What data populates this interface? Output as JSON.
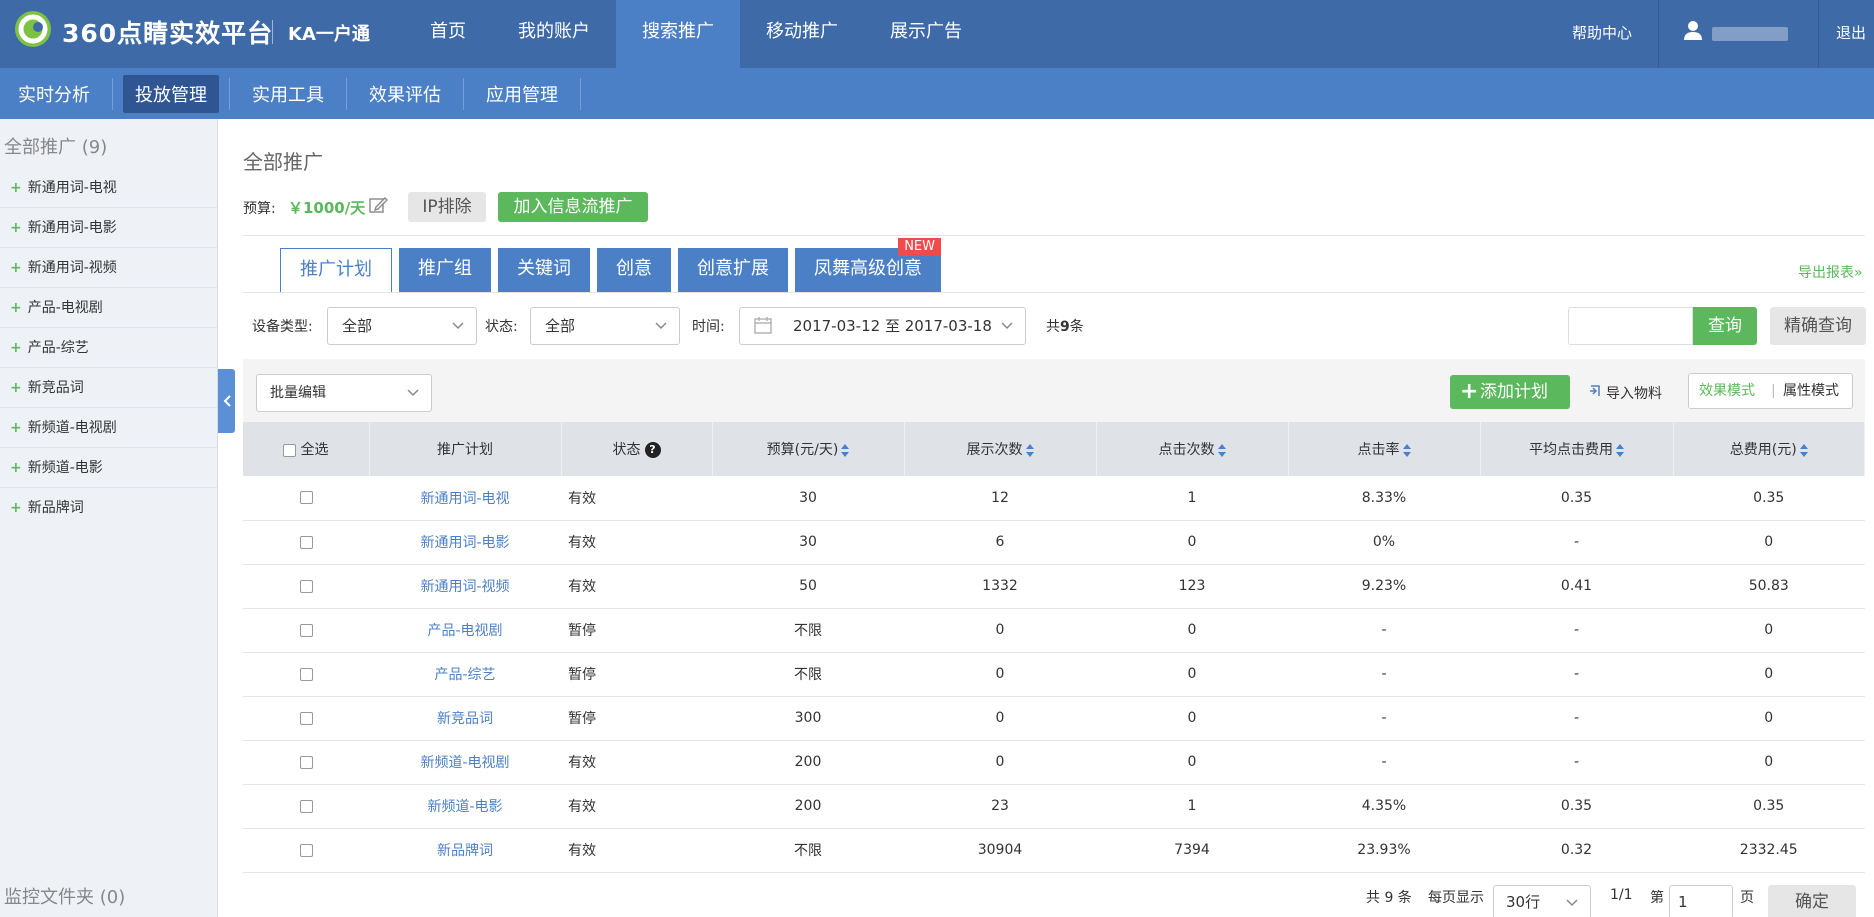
{
  "topbar": {
    "logo_text": "360点睛实效平台",
    "product": "KA一户通",
    "nav": [
      "首页",
      "我的账户",
      "搜索推广",
      "移动推广",
      "展示广告"
    ],
    "active_nav": "搜索推广",
    "help": "帮助中心",
    "logout": "退出"
  },
  "subbar": {
    "items": [
      "实时分析",
      "投放管理",
      "实用工具",
      "效果评估",
      "应用管理"
    ],
    "active": "投放管理"
  },
  "sidebar": {
    "title": "全部推广 (9)",
    "items": [
      "新通用词-电视",
      "新通用词-电影",
      "新通用词-视频",
      "产品-电视剧",
      "产品-综艺",
      "新竞品词",
      "新频道-电视剧",
      "新频道-电影",
      "新品牌词"
    ],
    "footer": "监控文件夹 (0)"
  },
  "main": {
    "title": "全部推广",
    "budget_label": "预算:",
    "budget_value": "￥1000/天",
    "ip_exclude": "IP排除",
    "add_feed": "加入信息流推广",
    "export": "导出报表»"
  },
  "tabs": {
    "items": [
      "推广计划",
      "推广组",
      "关键词",
      "创意",
      "创意扩展",
      "凤舞高级创意"
    ],
    "new_badge": "NEW"
  },
  "filters": {
    "device_label": "设备类型:",
    "device_value": "全部",
    "status_label": "状态:",
    "status_value": "全部",
    "time_label": "时间:",
    "date_range": "2017-03-12 至 2017-03-18",
    "count_prefix": "共",
    "count": "9",
    "count_suffix": "条",
    "search_btn": "查询",
    "precise_btn": "精确查询"
  },
  "toolbar": {
    "batch_edit": "批量编辑",
    "add_plan": "添加计划",
    "import": "导入物料",
    "mode_effect": "效果模式",
    "mode_sep": "|",
    "mode_attr": "属性模式"
  },
  "table": {
    "headers": {
      "select_all": "全选",
      "plan": "推广计划",
      "status": "状态",
      "budget": "预算(元/天)",
      "impressions": "展示次数",
      "clicks": "点击次数",
      "ctr": "点击率",
      "avg_cpc": "平均点击费用",
      "total_cost": "总费用(元)"
    },
    "rows": [
      {
        "plan": "新通用词-电视",
        "status": "有效",
        "budget": "30",
        "impressions": "12",
        "clicks": "1",
        "ctr": "8.33%",
        "avg_cpc": "0.35",
        "total_cost": "0.35"
      },
      {
        "plan": "新通用词-电影",
        "status": "有效",
        "budget": "30",
        "impressions": "6",
        "clicks": "0",
        "ctr": "0%",
        "avg_cpc": "-",
        "total_cost": "0"
      },
      {
        "plan": "新通用词-视频",
        "status": "有效",
        "budget": "50",
        "impressions": "1332",
        "clicks": "123",
        "ctr": "9.23%",
        "avg_cpc": "0.41",
        "total_cost": "50.83"
      },
      {
        "plan": "产品-电视剧",
        "status": "暂停",
        "budget": "不限",
        "impressions": "0",
        "clicks": "0",
        "ctr": "-",
        "avg_cpc": "-",
        "total_cost": "0"
      },
      {
        "plan": "产品-综艺",
        "status": "暂停",
        "budget": "不限",
        "impressions": "0",
        "clicks": "0",
        "ctr": "-",
        "avg_cpc": "-",
        "total_cost": "0"
      },
      {
        "plan": "新竞品词",
        "status": "暂停",
        "budget": "300",
        "impressions": "0",
        "clicks": "0",
        "ctr": "-",
        "avg_cpc": "-",
        "total_cost": "0"
      },
      {
        "plan": "新频道-电视剧",
        "status": "有效",
        "budget": "200",
        "impressions": "0",
        "clicks": "0",
        "ctr": "-",
        "avg_cpc": "-",
        "total_cost": "0"
      },
      {
        "plan": "新频道-电影",
        "status": "有效",
        "budget": "200",
        "impressions": "23",
        "clicks": "1",
        "ctr": "4.35%",
        "avg_cpc": "0.35",
        "total_cost": "0.35"
      },
      {
        "plan": "新品牌词",
        "status": "有效",
        "budget": "不限",
        "impressions": "30904",
        "clicks": "7394",
        "ctr": "23.93%",
        "avg_cpc": "0.32",
        "total_cost": "2332.45"
      }
    ]
  },
  "pager": {
    "total": "共 9 条",
    "per_page_label": "每页显示",
    "per_page": "30行",
    "pages": "1/1",
    "goto_label": "第",
    "goto_value": "1",
    "goto_suffix": "页",
    "ok": "确定"
  },
  "colors": {
    "primary_blue": "#3f6aa8",
    "sub_blue": "#4c80c6",
    "green": "#5cb85c",
    "badge_red": "#f04a4a"
  }
}
